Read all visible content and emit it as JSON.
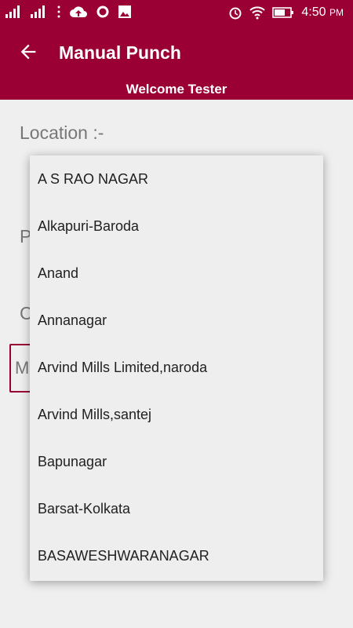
{
  "statusbar": {
    "time": "4:50",
    "ampm": "PM"
  },
  "appbar": {
    "title": "Manual Punch",
    "welcome": "Welcome  Tester"
  },
  "form": {
    "location_label": "Location :-",
    "partial_p": "P",
    "partial_c": "C",
    "partial_m": "M"
  },
  "dropdown": {
    "items": [
      "A S RAO NAGAR",
      "Alkapuri-Baroda",
      "Anand",
      "Annanagar",
      "Arvind Mills Limited,naroda",
      "Arvind Mills,santej",
      "Bapunagar",
      "Barsat-Kolkata",
      "BASAWESHWARANAGAR"
    ]
  },
  "colors": {
    "primary": "#9a0034",
    "background": "#efefef",
    "dropdown_bg": "#eeeeee"
  }
}
